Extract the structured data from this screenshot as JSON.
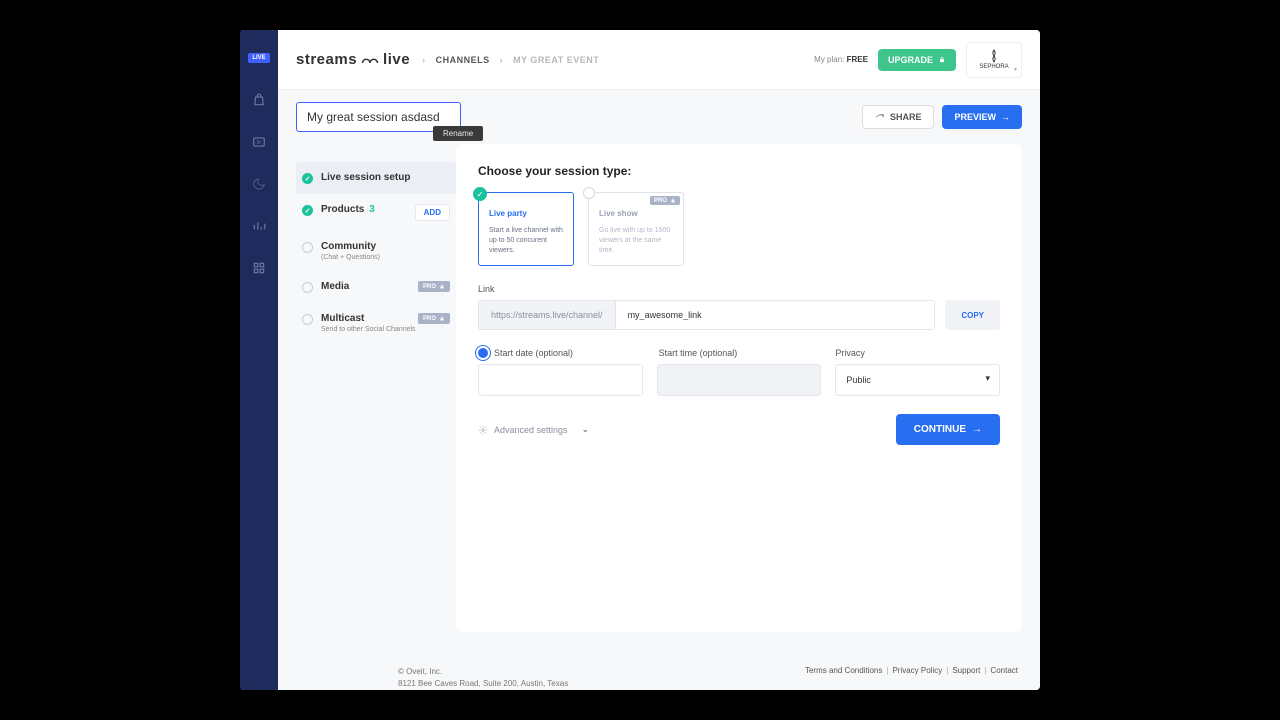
{
  "header": {
    "logo_text": "streams",
    "logo_suffix": "live",
    "breadcrumbs": {
      "channels": "CHANNELS",
      "current": "MY GREAT EVENT"
    },
    "plan_label": "My plan:",
    "plan_value": "FREE",
    "upgrade": "UPGRADE",
    "brand_name": "SEPHORA"
  },
  "title": {
    "value": "My great session asdasd",
    "rename_tooltip": "Rename"
  },
  "actions": {
    "share": "SHARE",
    "preview": "PREVIEW"
  },
  "steps": {
    "setup": "Live session setup",
    "products": "Products",
    "products_count": "3",
    "add": "ADD",
    "community": "Community",
    "community_sub": "(Chat + Questions)",
    "media": "Media",
    "multicast": "Multicast",
    "multicast_sub": "Send to other Social Channels",
    "pro": "PRO"
  },
  "panel": {
    "heading": "Choose your session type:",
    "types": {
      "party_title": "Live party",
      "party_desc": "Start a live channel with up to 50 concurent viewers.",
      "show_title": "Live show",
      "show_desc": "Go live with up to 1500 viewers at the same time."
    },
    "link_label": "Link",
    "link_prefix": "https://streams.live/channel/",
    "link_value": "my_awesome_link",
    "copy": "COPY",
    "start_date_label": "Start date (optional)",
    "start_time_label": "Start time (optional)",
    "privacy_label": "Privacy",
    "privacy_value": "Public",
    "advanced": "Advanced settings",
    "continue": "CONTINUE"
  },
  "footer": {
    "copyright": "© Oveit, Inc.",
    "address": "8121 Bee Caves Road, Suite 200, Austin, Texas",
    "terms": "Terms and Conditions",
    "privacy": "Privacy Policy",
    "support": "Support",
    "contact": "Contact"
  }
}
